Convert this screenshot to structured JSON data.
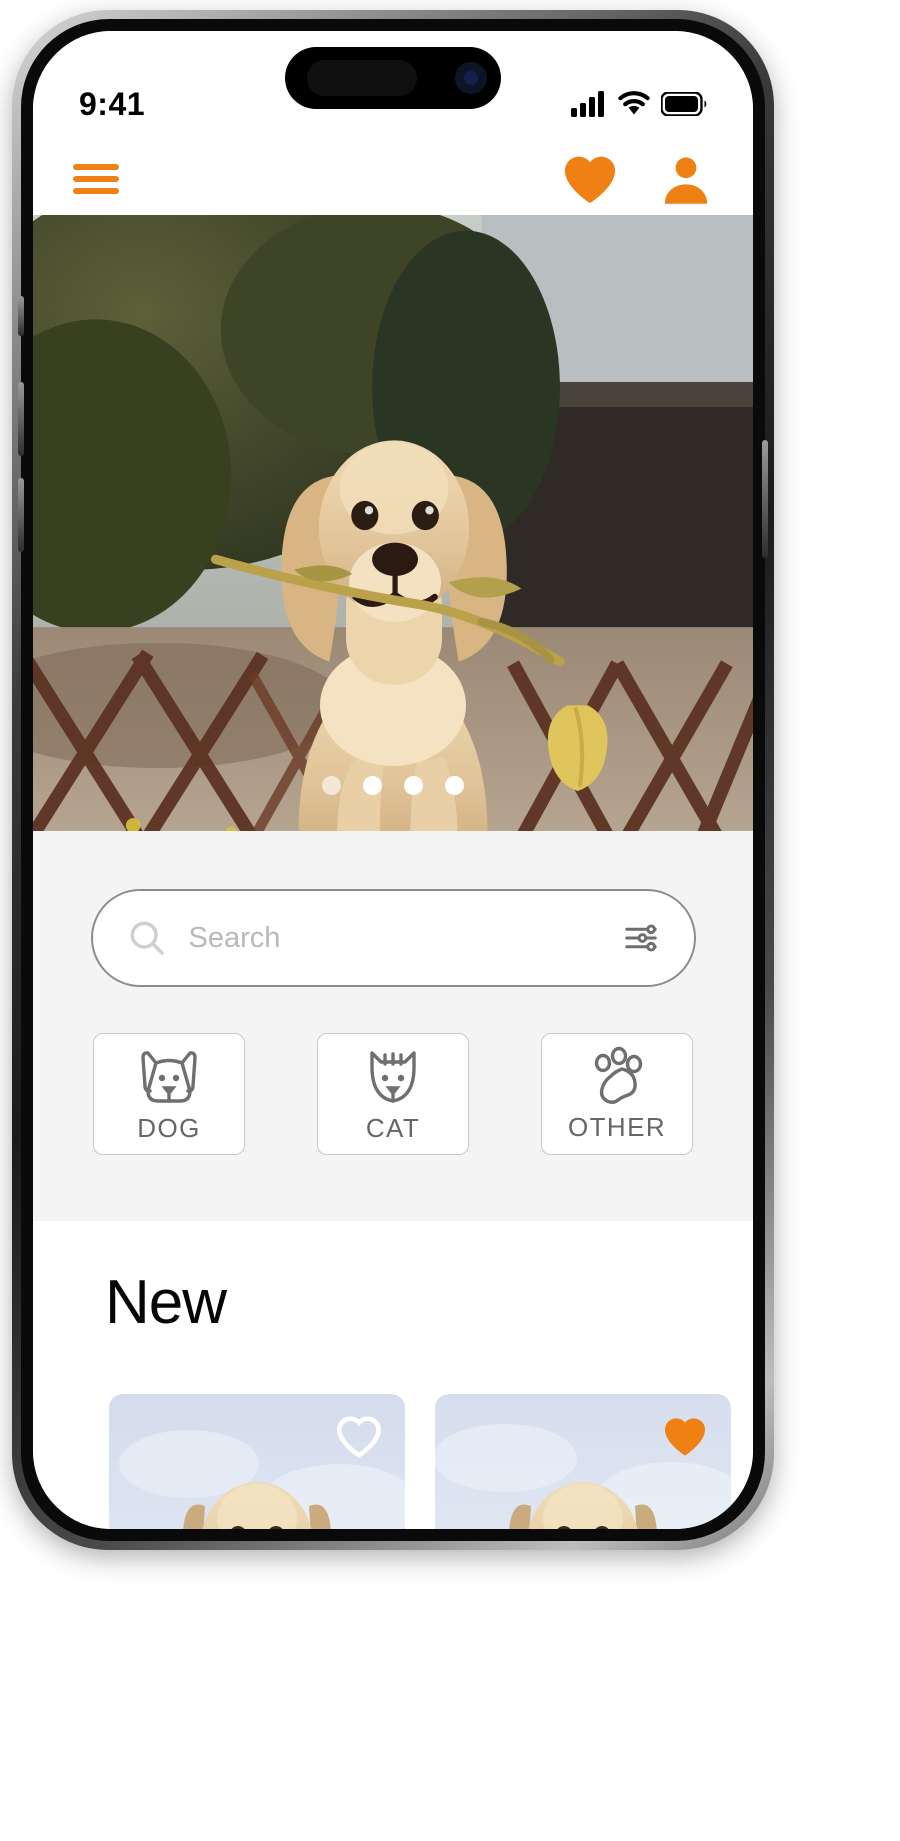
{
  "device": {
    "status_bar": {
      "time": "9:41",
      "cellular_icon": "cellular-signal-icon",
      "wifi_icon": "wifi-icon",
      "battery_icon": "battery-icon"
    }
  },
  "header": {
    "menu_icon": "hamburger-menu-icon",
    "favorites_icon": "heart-filled-icon",
    "profile_icon": "user-profile-icon",
    "accent_color": "#ee8014"
  },
  "hero": {
    "alt": "golden retriever puppy holding a tulip flower in its mouth in front of a wooden fence",
    "carousel": {
      "total_dots": 4,
      "active_index": 0,
      "dots": [
        "dot-1",
        "dot-2",
        "dot-3",
        "dot-4"
      ]
    }
  },
  "search": {
    "placeholder": "Search",
    "value": "",
    "search_icon": "search-icon",
    "filter_icon": "filter-sliders-icon"
  },
  "categories": [
    {
      "label": "DOG",
      "icon": "dog-face-icon"
    },
    {
      "label": "CAT",
      "icon": "cat-face-icon"
    },
    {
      "label": "OTHER",
      "icon": "paw-print-icon"
    }
  ],
  "new_section": {
    "title": "New",
    "cards": [
      {
        "alt": "labrador puppy in snow wearing a red scarf",
        "favorited": false,
        "fav_icon": "heart-outline-icon"
      },
      {
        "alt": "labrador puppy in snow wearing a red scarf",
        "favorited": true,
        "fav_icon": "heart-filled-icon"
      }
    ]
  },
  "colors": {
    "accent": "#ee8014",
    "panel_bg": "#f4f4f4",
    "page_bg": "#ffffff",
    "text_primary": "#050505",
    "text_muted": "#666666",
    "placeholder": "#b9b9b9"
  }
}
